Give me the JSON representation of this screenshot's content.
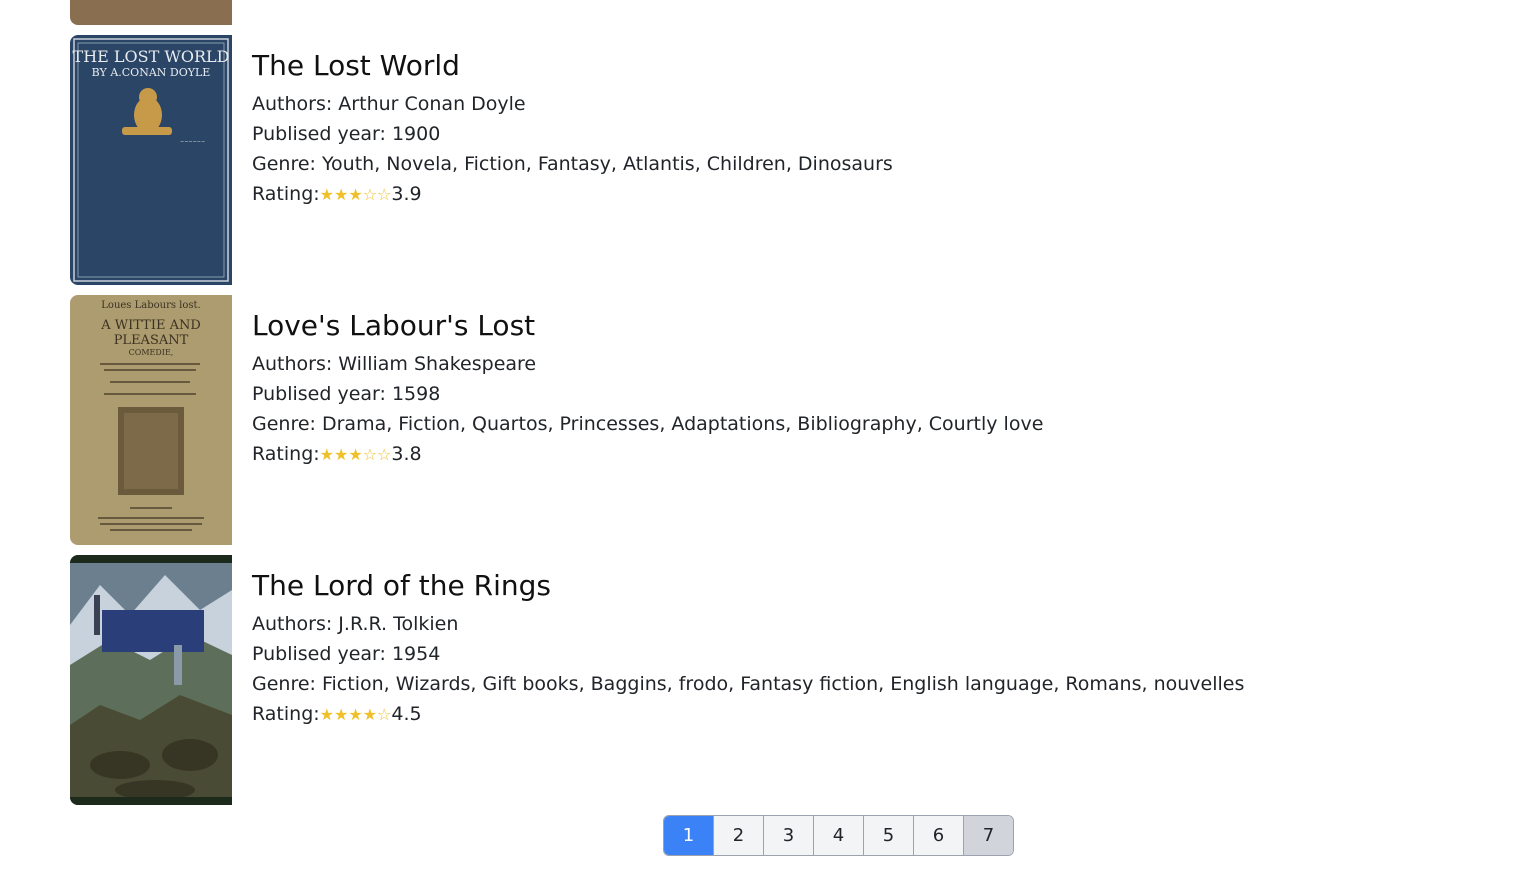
{
  "books": [
    {
      "title": "The Lost World",
      "authors_label": "Authors: Arthur Conan Doyle",
      "year_label": "Publised year: 1900",
      "genre_label": "Genre: Youth, Novela, Fiction, Fantasy, Atlantis, Children, Dinosaurs",
      "rating_prefix": "Rating:",
      "stars": "★★★☆☆",
      "rating": "3.9",
      "cover_text_1": "THE LOST WORLD",
      "cover_text_2": "BY A.CONAN DOYLE"
    },
    {
      "title": "Love's Labour's Lost",
      "authors_label": "Authors: William Shakespeare",
      "year_label": "Publised year: 1598",
      "genre_label": "Genre: Drama, Fiction, Quartos, Princesses, Adaptations, Bibliography, Courtly love",
      "rating_prefix": "Rating:",
      "stars": "★★★☆☆",
      "rating": "3.8",
      "cover_text_1": "Loues Labours lost.",
      "cover_text_2": "A WITTIE AND",
      "cover_text_3": "PLEASANT",
      "cover_text_4": "COMEDIE,"
    },
    {
      "title": "The Lord of the Rings",
      "authors_label": "Authors: J.R.R. Tolkien",
      "year_label": "Publised year: 1954",
      "genre_label": "Genre: Fiction, Wizards, Gift books, Baggins, frodo, Fantasy fiction, English language, Romans, nouvelles",
      "rating_prefix": "Rating:",
      "stars": "★★★★☆",
      "rating": "4.5"
    }
  ],
  "pagination": {
    "pages": [
      "1",
      "2",
      "3",
      "4",
      "5",
      "6",
      "7"
    ],
    "active": "1"
  },
  "colors": {
    "star": "#f0c02a",
    "active_page": "#3b82f6"
  }
}
